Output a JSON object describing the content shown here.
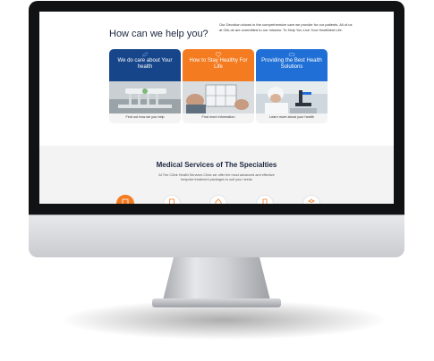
{
  "help": {
    "title": "How can we help you?",
    "intro": "Our Devotion shows in the comprehensive care we provide for our patients. All of us at Clik-ok are committed to our mission: To Help You Live Your Healthiest Life."
  },
  "cards": [
    {
      "title": "We do care about Your health",
      "link": "Find out how we you help",
      "color": "#16458a"
    },
    {
      "title": "How to Stay Healthy For Life",
      "link": "Find more information",
      "color": "#f47b20"
    },
    {
      "title": "Providing the Best Health Solutions",
      "link": "Learn more about your health",
      "color": "#1f6fd6"
    }
  ],
  "services": {
    "title": "Medical Services of The Specialties",
    "subtitle": "At The Cilink Health Services Clinic we offer the most advanced and effective bespoke treatment packages to suit your needs",
    "icons": [
      "hospital-icon",
      "clipboard-icon",
      "house-icon",
      "folder-icon",
      "book-icon"
    ]
  },
  "colors": {
    "accent": "#f47b20",
    "navy": "#1c2740"
  }
}
